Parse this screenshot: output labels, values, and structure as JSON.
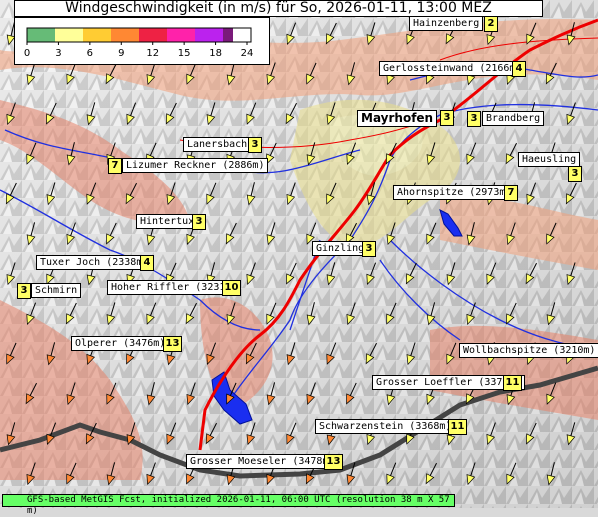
{
  "title": "Windgeschwindigkeit (in m/s) für So, 2026-01-11, 13:00 MEZ",
  "legend": {
    "ticks": [
      "0",
      "3",
      "6",
      "9",
      "12",
      "15",
      "18",
      "24"
    ],
    "colors": [
      "#66bb77",
      "#ffff99",
      "#ffcc33",
      "#ff8833",
      "#ee2244",
      "#ff22aa",
      "#bb22ee",
      "#7a1a7a"
    ]
  },
  "places": [
    {
      "name": "Hainzenberg",
      "value": "2",
      "kind": "peak"
    },
    {
      "name": "Gerlossteinwand (2166m)",
      "value": "4",
      "kind": "peak"
    },
    {
      "name": "Mayrhofen",
      "value": "3",
      "kind": "town"
    },
    {
      "name": "Brandberg",
      "value": "3",
      "kind": "peak"
    },
    {
      "name": "Lanersbach",
      "value": "3",
      "kind": "peak"
    },
    {
      "name": "Haeusling",
      "value": "3",
      "kind": "peak"
    },
    {
      "name": "Lizumer Reckner (2886m)",
      "value": "7",
      "kind": "peak"
    },
    {
      "name": "Ahornspitze (2973m)",
      "value": "7",
      "kind": "peak"
    },
    {
      "name": "Hintertux",
      "value": "3",
      "kind": "peak"
    },
    {
      "name": "Ginzling",
      "value": "3",
      "kind": "peak"
    },
    {
      "name": "Tuxer Joch (2338m)",
      "value": "4",
      "kind": "peak"
    },
    {
      "name": "Schmirn",
      "value": "3",
      "kind": "peak"
    },
    {
      "name": "Hoher Riffler (3231m)",
      "value": "10",
      "kind": "peak"
    },
    {
      "name": "Olperer (3476m)",
      "value": "13",
      "kind": "peak"
    },
    {
      "name": "Wollbachspitze (3210m)",
      "value": "",
      "kind": "peak"
    },
    {
      "name": "Grosser Loeffler (3376m)",
      "value": "11",
      "kind": "peak"
    },
    {
      "name": "Schwarzenstein (3368m)",
      "value": "11",
      "kind": "peak"
    },
    {
      "name": "Grosser Moeseler (3478m)",
      "value": "13",
      "kind": "peak"
    }
  ],
  "footer": "GFS-based MetGIS Fcst, initialized 2026-01-11, 06:00 UTC  (resolution 38 m X 57 m)"
}
